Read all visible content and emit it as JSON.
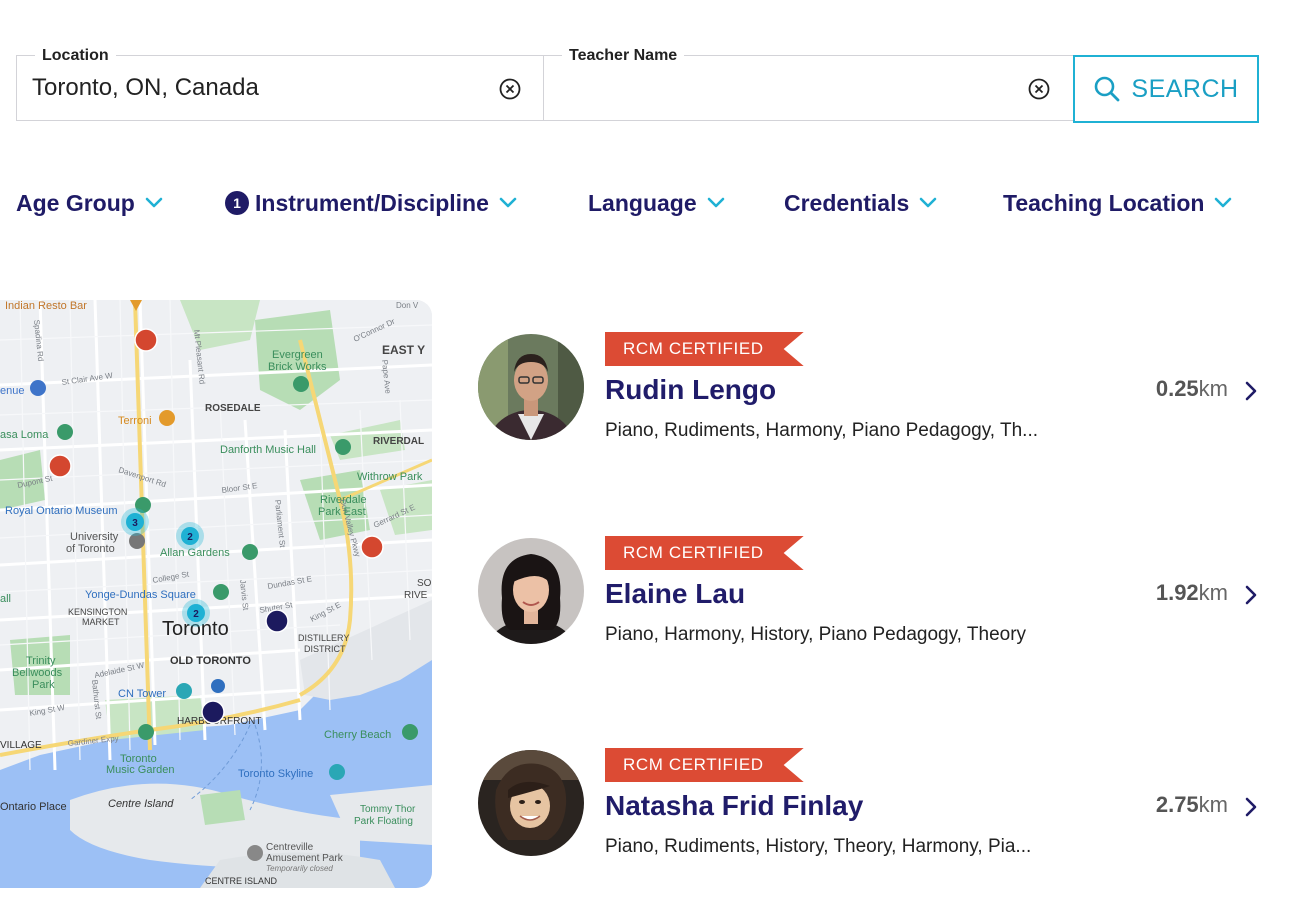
{
  "search": {
    "location_label": "Location",
    "location_value": "Toronto, ON, Canada",
    "teacher_label": "Teacher Name",
    "teacher_value": "",
    "button_label": "SEARCH"
  },
  "filters": [
    {
      "label": "Age Group",
      "badge": ""
    },
    {
      "label": "Instrument/Discipline",
      "badge": "1"
    },
    {
      "label": "Language",
      "badge": ""
    },
    {
      "label": "Credentials",
      "badge": ""
    },
    {
      "label": "Teaching Location",
      "badge": ""
    }
  ],
  "map": {
    "labels": {
      "indian_resto": "Indian Resto Bar",
      "east_york": "EAST Y",
      "evergreen": "Evergreen",
      "brick_works": "Brick Works",
      "rosedale": "ROSEDALE",
      "terroni": "Terroni",
      "casa_loma": "asa Loma",
      "enue": "enue",
      "riverdale": "RIVERDAL",
      "danforth": "Danforth Music Hall",
      "withrow": "Withrow Park",
      "riverdale_park": "Riverdale",
      "riverdale_park2": "Park East",
      "rom": "Royal Ontario Museum",
      "uoft1": "University",
      "uoft2": "of Toronto",
      "allan": "Allan Gardens",
      "yonge_dundas": "Yonge-Dundas Square",
      "kensington1": "KENSINGTON",
      "kensington2": "MARKET",
      "toronto": "Toronto",
      "distillery1": "DISTILLERY",
      "distillery2": "DISTRICT",
      "old_toronto": "OLD TORONTO",
      "trinity1": "Trinity",
      "trinity2": "Bellwoods",
      "trinity3": "Park",
      "cn_tower": "CN Tower",
      "harbourfront": "HARBOURFRONT",
      "village": "VILLAGE",
      "cherry_beach": "Cherry Beach",
      "music_garden1": "Toronto",
      "music_garden2": "Music Garden",
      "skyline": "Toronto Skyline",
      "ontario_place": "Ontario Place",
      "centre_island": "Centre Island",
      "tommy1": "Tommy Thor",
      "tommy2": "Park Floating",
      "centreville1": "Centreville",
      "centreville2": "Amusement Park",
      "centreville3": "Temporarily closed",
      "centre_island_caps": "CENTRE ISLAND",
      "so": "SO",
      "rive": "RIVE",
      "all": "all",
      "st_clair": "St Clair Ave W",
      "davenport": "Davenport Rd",
      "dupont": "Dupont St",
      "bloor": "Bloor St E",
      "college": "College St",
      "dundas": "Dundas St E",
      "shuter": "Shuter St",
      "king_e": "King St E",
      "king_w": "King St W",
      "adelaide": "Adelaide St W",
      "gardiner": "Gardiner Expy",
      "gerrard": "Gerrard St E",
      "dvp": "Don Valley Pkwy",
      "parliament": "Parliament St",
      "jarvis": "Jarvis St",
      "mt_pleasant": "Mt Pleasant Rd",
      "pape": "Pape Ave",
      "oconnor": "O'Connor Dr",
      "bathurst": "Bathurst St",
      "spadina": "Spadina Rd",
      "don_v": "Don V"
    },
    "clusters": [
      "3",
      "2",
      "2"
    ]
  },
  "results": [
    {
      "badge": "RCM CERTIFIED",
      "name": "Rudin Lengo",
      "disciplines": "Piano, Rudiments, Harmony, Piano Pedagogy, Th...",
      "distance_value": "0.25",
      "distance_unit": "km"
    },
    {
      "badge": "RCM CERTIFIED",
      "name": "Elaine Lau",
      "disciplines": "Piano, Harmony, History, Piano Pedagogy, Theory",
      "distance_value": "1.92",
      "distance_unit": "km"
    },
    {
      "badge": "RCM CERTIFIED",
      "name": "Natasha Frid Finlay",
      "disciplines": "Piano, Rudiments, History, Theory, Harmony, Pia...",
      "distance_value": "2.75",
      "distance_unit": "km"
    }
  ],
  "colors": {
    "brand_navy": "#1f1b66",
    "accent_cyan": "#1fb1d4",
    "certified_red": "#dc4b34",
    "marker_red": "#d4472f",
    "marker_navy": "#1c1a5e"
  }
}
